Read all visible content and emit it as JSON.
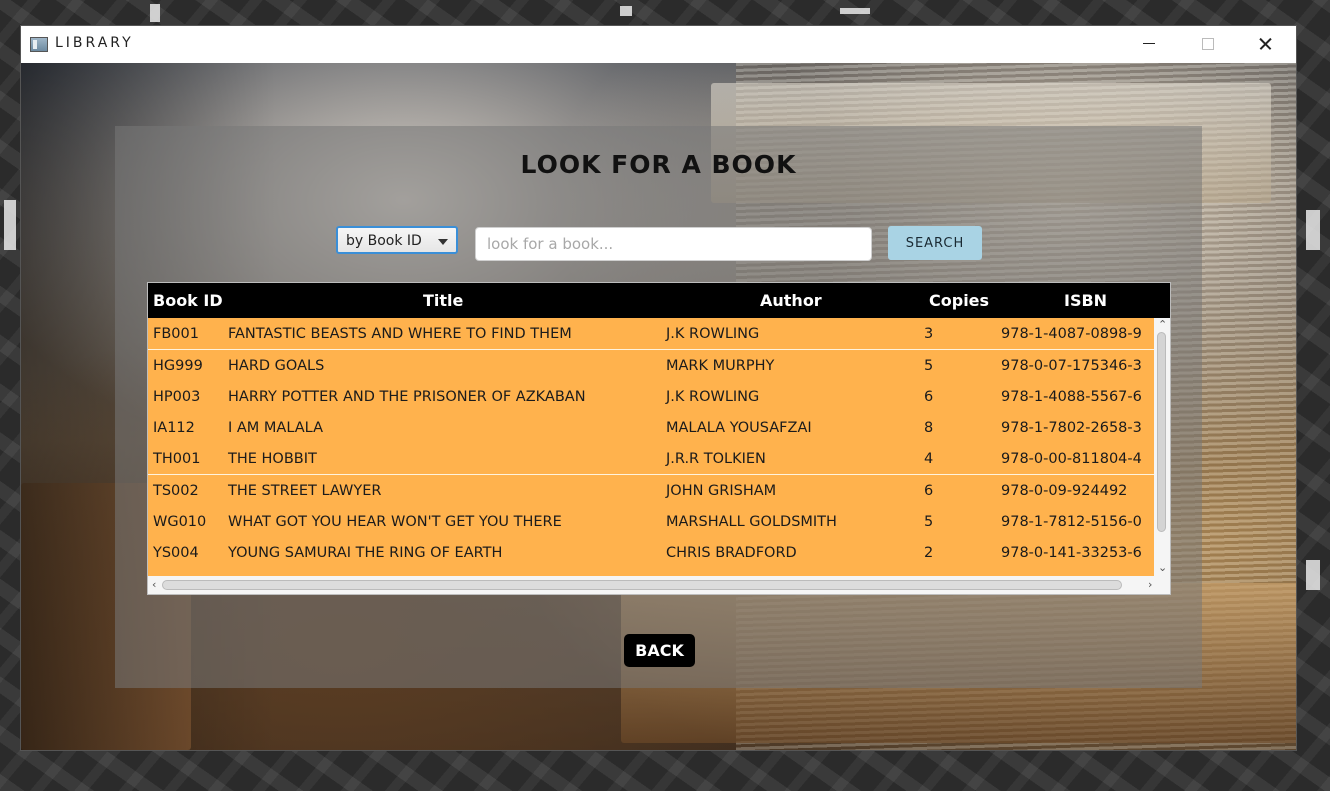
{
  "window": {
    "title": "LIBRARY"
  },
  "page": {
    "heading": "LOOK FOR A BOOK"
  },
  "search": {
    "filter_selected": "by Book ID",
    "placeholder": "look for a book...",
    "value": "",
    "button_label": "SEARCH"
  },
  "table": {
    "columns": [
      "Book ID",
      "Title",
      "Author",
      "Copies",
      "ISBN"
    ],
    "rows": [
      {
        "id": "FB001",
        "title": "FANTASTIC BEASTS AND WHERE TO FIND THEM",
        "author": "J.K ROWLING",
        "copies": "3",
        "isbn": "978-1-4087-0898-9"
      },
      {
        "id": "HG999",
        "title": "HARD GOALS",
        "author": "MARK MURPHY",
        "copies": "5",
        "isbn": "978-0-07-175346-3"
      },
      {
        "id": "HP003",
        "title": "HARRY POTTER AND THE PRISONER OF AZKABAN",
        "author": "J.K ROWLING",
        "copies": "6",
        "isbn": "978-1-4088-5567-6"
      },
      {
        "id": "IA112",
        "title": "I AM MALALA",
        "author": "MALALA YOUSAFZAI",
        "copies": "8",
        "isbn": "978-1-7802-2658-3"
      },
      {
        "id": "TH001",
        "title": "THE HOBBIT",
        "author": "J.R.R TOLKIEN",
        "copies": "4",
        "isbn": "978-0-00-811804-4"
      },
      {
        "id": "TS002",
        "title": "THE STREET LAWYER",
        "author": "JOHN GRISHAM",
        "copies": "6",
        "isbn": "978-0-09-924492"
      },
      {
        "id": "WG010",
        "title": "WHAT GOT YOU HEAR WON'T GET YOU THERE",
        "author": "MARSHALL GOLDSMITH",
        "copies": "5",
        "isbn": "978-1-7812-5156-0"
      },
      {
        "id": "YS004",
        "title": "YOUNG SAMURAI THE RING OF EARTH",
        "author": "CHRIS BRADFORD",
        "copies": "2",
        "isbn": "978-0-141-33253-6"
      }
    ]
  },
  "footer": {
    "back_label": "BACK"
  },
  "colors": {
    "row_background": "#ffb24d",
    "header_background": "#000000",
    "search_button": "#a9d3e4",
    "panel_overlay": "#787878"
  }
}
